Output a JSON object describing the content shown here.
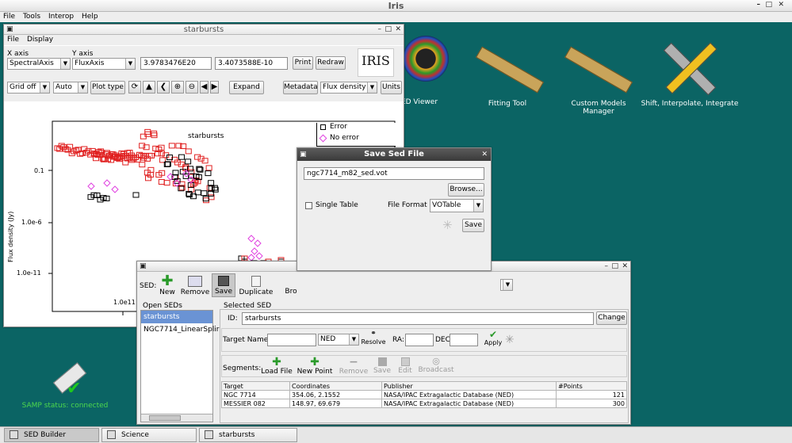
{
  "top": {
    "title": "Iris",
    "menu": [
      "File",
      "Tools",
      "Interop",
      "Help"
    ]
  },
  "desktop": {
    "sed_viewer": "ED Viewer",
    "fitting": "Fitting Tool",
    "custom": "Custom Models Manager",
    "shift": "Shift, Interpolate, Integrate",
    "samp": "SAMP status: connected"
  },
  "starbursts": {
    "title": "starbursts",
    "menu": [
      "File",
      "Display"
    ],
    "xaxis_label": "X axis",
    "yaxis_label": "Y axis",
    "xaxis_value": "SpectralAxis",
    "yaxis_value": "FluxAxis",
    "xval": "3.9783476E20",
    "yval": "3.4073588E-10",
    "print": "Print",
    "redraw": "Redraw",
    "logo": "IRIS",
    "grid": "Grid off",
    "auto": "Auto",
    "plot_type": "Plot type",
    "expand": "Expand",
    "metadata": "Metadata",
    "flux_density": "Flux density",
    "units": "Units",
    "plot_title": "starbursts",
    "ylabel": "Flux density (Jy)",
    "yticks": [
      "0.1",
      "1.0e-6",
      "1.0e-11"
    ],
    "xtick": "1.0e11",
    "legend": [
      "Error",
      "No error"
    ]
  },
  "savedlg": {
    "title": "Save Sed File",
    "filename": "ngc7714_m82_sed.vot",
    "browse": "Browse...",
    "single": "Single Table",
    "fmt_label": "File Format",
    "fmt": "VOTable",
    "save": "Save"
  },
  "builder": {
    "sed_label": "SED:",
    "new": "New",
    "remove": "Remove",
    "save": "Save",
    "duplicate": "Duplicate",
    "bro": "Bro",
    "open_seds": "Open SEDs",
    "items": [
      "starbursts (Segment",
      "NGC7714_LinearSplir"
    ],
    "selected": "Selected SED",
    "id_label": "ID:",
    "id": "starbursts",
    "change": "Change",
    "target_name": "Target Name:",
    "ned": "NED",
    "resolve": "Resolve",
    "ra": "RA:",
    "dec": "DEC:",
    "apply": "Apply",
    "segments": "Segments:",
    "load_file": "Load File",
    "new_point": "New Point",
    "seg_remove": "Remove",
    "seg_save": "Save",
    "edit": "Edit",
    "broadcast": "Broadcast",
    "headers": [
      "Target",
      "Coordinates",
      "Publisher",
      "#Points"
    ],
    "rows": [
      [
        "NGC 7714",
        "354.06, 2.1552",
        "NASA/IPAC Extragalactic Database (NED)",
        "121"
      ],
      [
        "MESSIER 082",
        "148.97, 69.679",
        "NASA/IPAC Extragalactic Database (NED)",
        "300"
      ]
    ]
  },
  "taskbar": [
    "SED Builder",
    "Science",
    "starbursts"
  ],
  "colors": {
    "desktop": "#0b6464",
    "error": "#000000",
    "noerror": "#e040e0",
    "red": "#e02020"
  }
}
